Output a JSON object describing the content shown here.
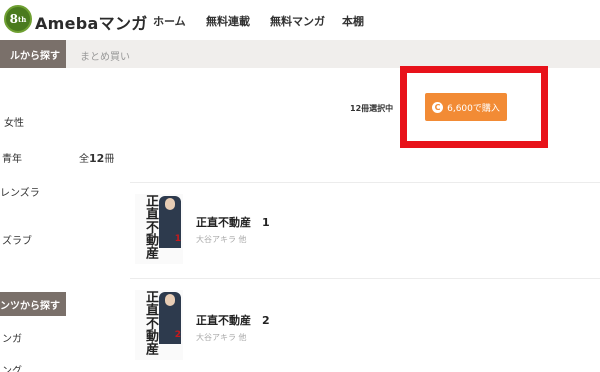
{
  "header": {
    "badge_text": "8",
    "badge_small": "th",
    "logo": "Amebaマンガ",
    "nav": [
      "ホーム",
      "無料連載",
      "無料マンガ",
      "本棚"
    ]
  },
  "subbar": {
    "left_label": "ルから探す",
    "right_label": "まとめ買い"
  },
  "sidebar": {
    "items": [
      "女性",
      "青年",
      "レンズラ",
      "ズラブ"
    ],
    "section_label": "テンツから探す",
    "section_items": [
      "ンガ",
      "ング"
    ]
  },
  "purchase": {
    "selected_text": "12冊選択中",
    "button_label": "6,600で購入",
    "coin_symbol": "C",
    "accent": "#f28b35",
    "highlight_color": "#e8121a"
  },
  "total": {
    "prefix": "全",
    "count": "12",
    "suffix": "冊"
  },
  "books": [
    {
      "title": "正直不動産　1",
      "author": "大谷アキラ 他",
      "cover_title": "正直不動産",
      "cover_num": "1"
    },
    {
      "title": "正直不動産　2",
      "author": "大谷アキラ 他",
      "cover_title": "正直不動産",
      "cover_num": "2"
    }
  ]
}
